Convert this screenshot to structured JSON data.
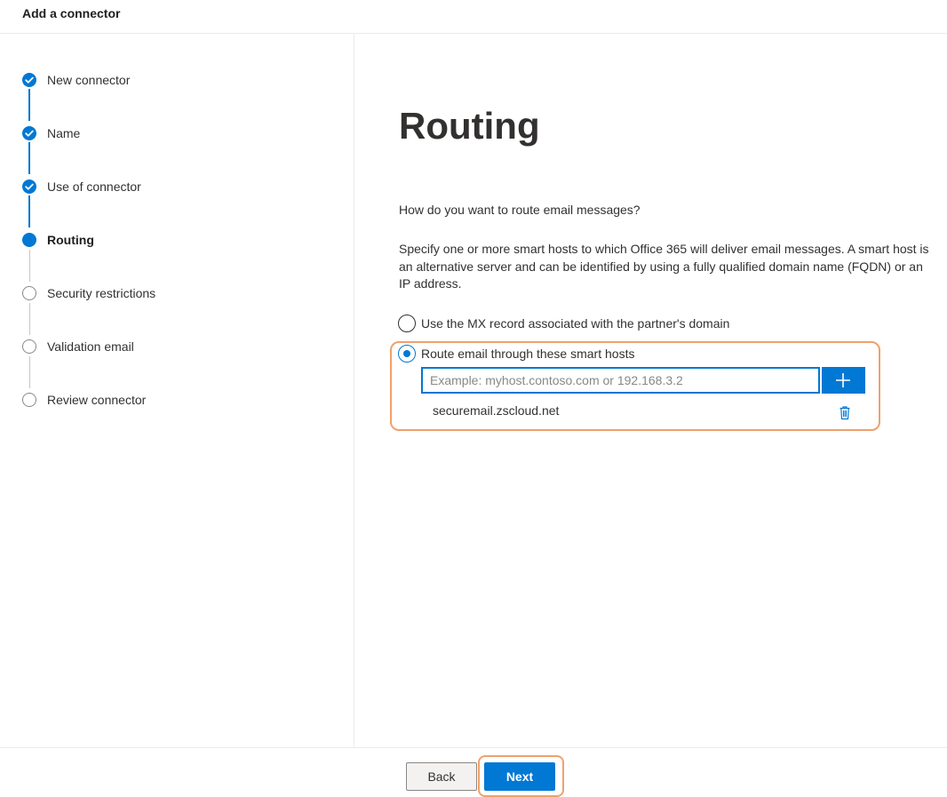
{
  "header": {
    "title": "Add a connector"
  },
  "stepper": {
    "steps": [
      {
        "label": "New connector",
        "state": "done"
      },
      {
        "label": "Name",
        "state": "done"
      },
      {
        "label": "Use of connector",
        "state": "done"
      },
      {
        "label": "Routing",
        "state": "current"
      },
      {
        "label": "Security restrictions",
        "state": "todo"
      },
      {
        "label": "Validation email",
        "state": "todo"
      },
      {
        "label": "Review connector",
        "state": "todo"
      }
    ]
  },
  "main": {
    "title": "Routing",
    "question": "How do you want to route email messages?",
    "description": "Specify one or more smart hosts to which Office 365 will deliver email messages. A smart host is an alternative server and can be identified by using a fully qualified domain name (FQDN) or an IP address.",
    "options": [
      {
        "label": "Use the MX record associated with the partner's domain",
        "selected": false
      },
      {
        "label": "Route email through these smart hosts",
        "selected": true
      }
    ],
    "host_input": {
      "value": "",
      "placeholder": "Example: myhost.contoso.com or 192.168.3.2"
    },
    "smart_hosts": [
      "securemail.zscloud.net"
    ]
  },
  "footer": {
    "back_label": "Back",
    "next_label": "Next"
  },
  "colors": {
    "accent": "#0078d4",
    "highlight": "#f0a16c"
  },
  "icons": {
    "check": "checkmark-icon",
    "add": "plus-icon",
    "delete": "trash-icon"
  }
}
